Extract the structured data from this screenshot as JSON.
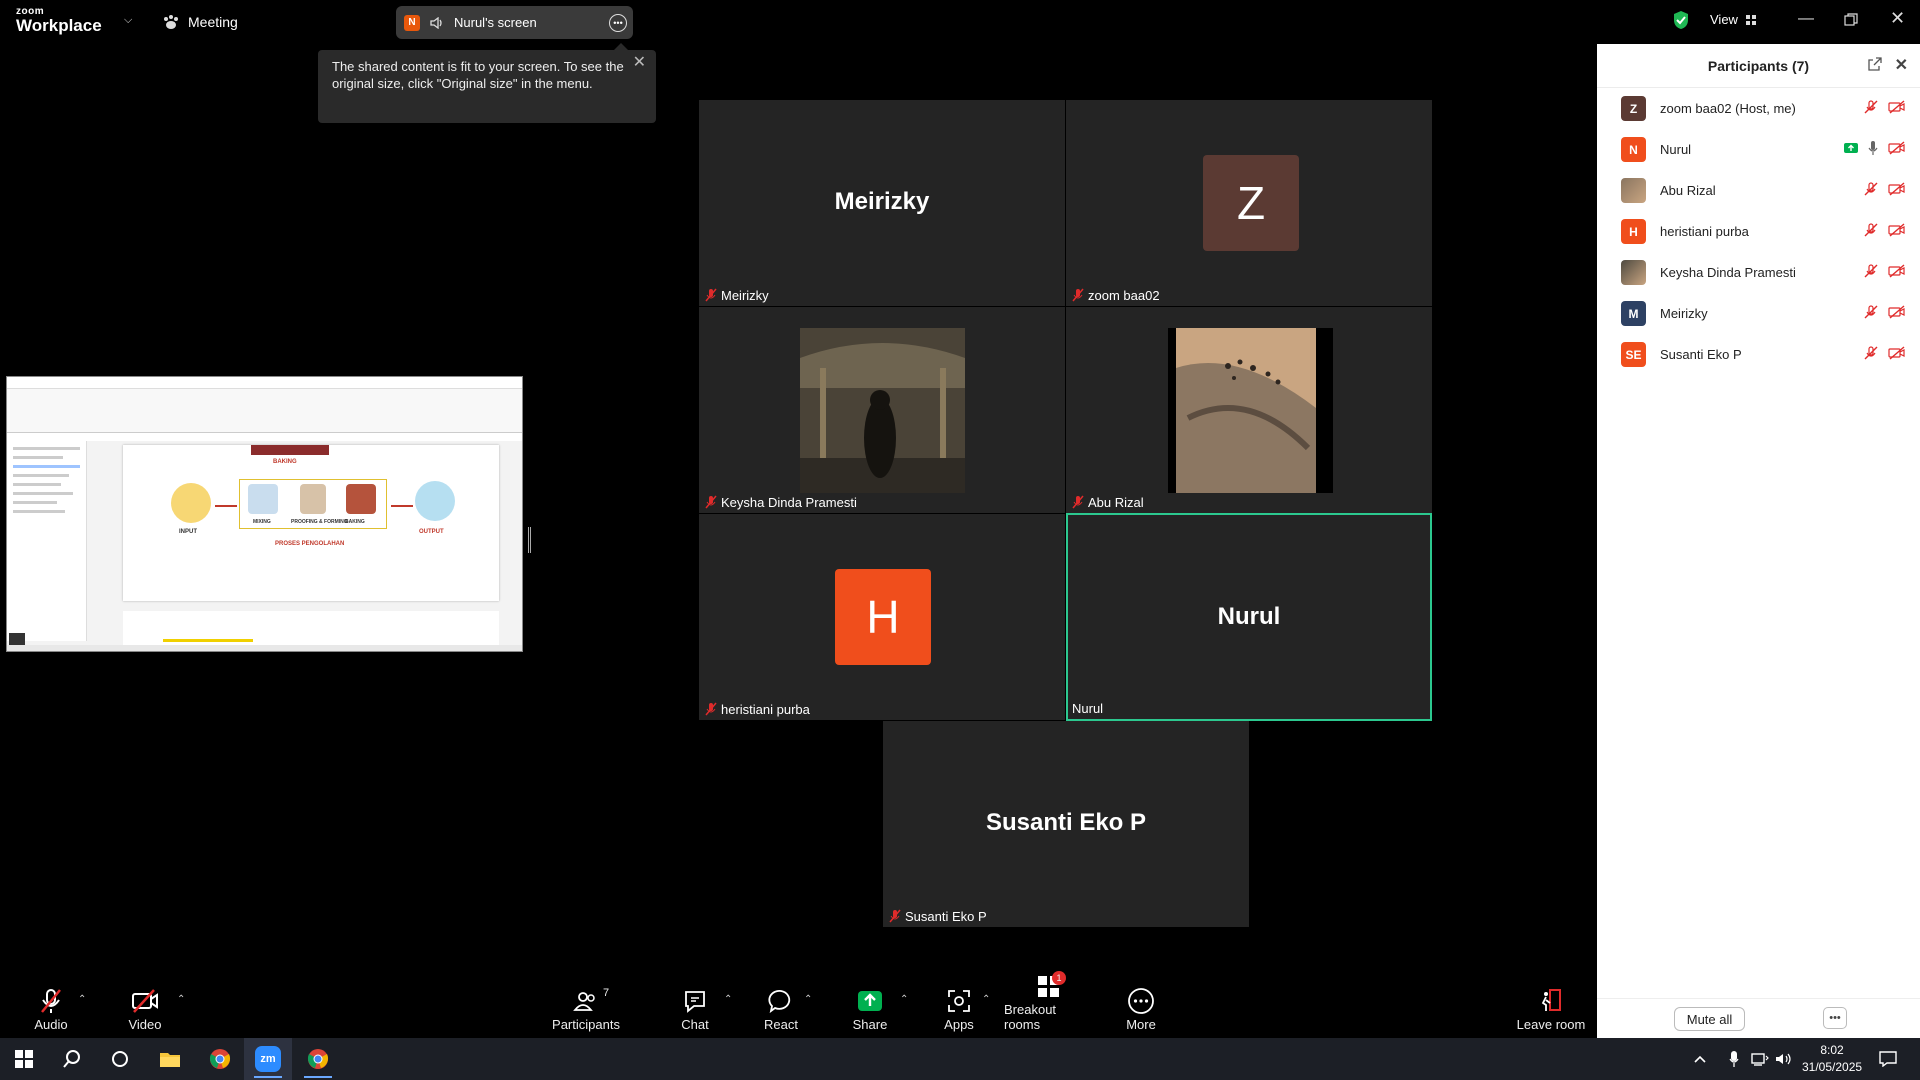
{
  "app": {
    "logo_top": "zoom",
    "logo_bottom": "Workplace",
    "meeting_label": "Meeting",
    "share_badge": "N",
    "share_title": "Nurul's screen",
    "view_label": "View"
  },
  "tooltip": {
    "text": "The shared content is fit to your screen. To see the original size, click \"Original size\" in the menu."
  },
  "shared_doc": {
    "heading": "BAKING",
    "input_label": "INPUT",
    "output_label": "OUTPUT",
    "process_label": "PROSES PENGOLAHAN",
    "mixing": "MIXING",
    "forming": "PROOFING & FORMING",
    "baking_step": "BAKING"
  },
  "gallery": [
    {
      "id": "meirizky",
      "name": "Meirizky",
      "display": "name",
      "big": "Meirizky",
      "muted": true
    },
    {
      "id": "zoom-baa02",
      "name": "zoom baa02",
      "display": "avatar",
      "big": "Z",
      "color": "#5b3a33",
      "muted": true
    },
    {
      "id": "keysha",
      "name": "Keysha Dinda Pramesti",
      "display": "photo",
      "muted": true
    },
    {
      "id": "abu-rizal",
      "name": "Abu Rizal",
      "display": "photo",
      "muted": true
    },
    {
      "id": "heristiani",
      "name": "heristiani purba",
      "display": "avatar",
      "big": "H",
      "color": "#f04e1c",
      "muted": true
    },
    {
      "id": "nurul",
      "name": "Nurul",
      "display": "name",
      "big": "Nurul",
      "muted": false,
      "active": true
    },
    {
      "id": "susanti",
      "name": "Susanti Eko P",
      "display": "name",
      "big": "Susanti Eko P",
      "muted": true
    }
  ],
  "panel": {
    "title": "Participants (7)",
    "participants": [
      {
        "initials": "Z",
        "name": "zoom baa02 (Host, me)",
        "color": "#5b3a33",
        "mic": "muted",
        "sharing": false
      },
      {
        "initials": "N",
        "name": "Nurul",
        "color": "#f04e1c",
        "mic": "on",
        "sharing": true
      },
      {
        "initials": "",
        "name": "Abu Rizal",
        "color": "#8a7560",
        "mic": "muted",
        "sharing": false,
        "photo": true
      },
      {
        "initials": "H",
        "name": "heristiani purba",
        "color": "#f04e1c",
        "mic": "muted",
        "sharing": false
      },
      {
        "initials": "",
        "name": "Keysha Dinda Pramesti",
        "color": "#4e4a40",
        "mic": "muted",
        "sharing": false,
        "photo": true
      },
      {
        "initials": "M",
        "name": "Meirizky",
        "color": "#2d4163",
        "mic": "muted",
        "sharing": false
      },
      {
        "initials": "SE",
        "name": "Susanti Eko P",
        "color": "#f04e1c",
        "mic": "muted",
        "sharing": false
      }
    ],
    "mute_all": "Mute all"
  },
  "toolbar": {
    "audio": "Audio",
    "video": "Video",
    "participants": "Participants",
    "participants_count": "7",
    "chat": "Chat",
    "react": "React",
    "share": "Share",
    "apps": "Apps",
    "breakout": "Breakout rooms",
    "breakout_badge": "1",
    "more": "More",
    "leave": "Leave room"
  },
  "taskbar": {
    "time": "8:02",
    "date": "31/05/2025"
  },
  "colors": {
    "zoom_green": "#00b050",
    "active_border": "#2cc88f",
    "muted_red": "#e02b2b",
    "tile_bg": "#242424"
  }
}
